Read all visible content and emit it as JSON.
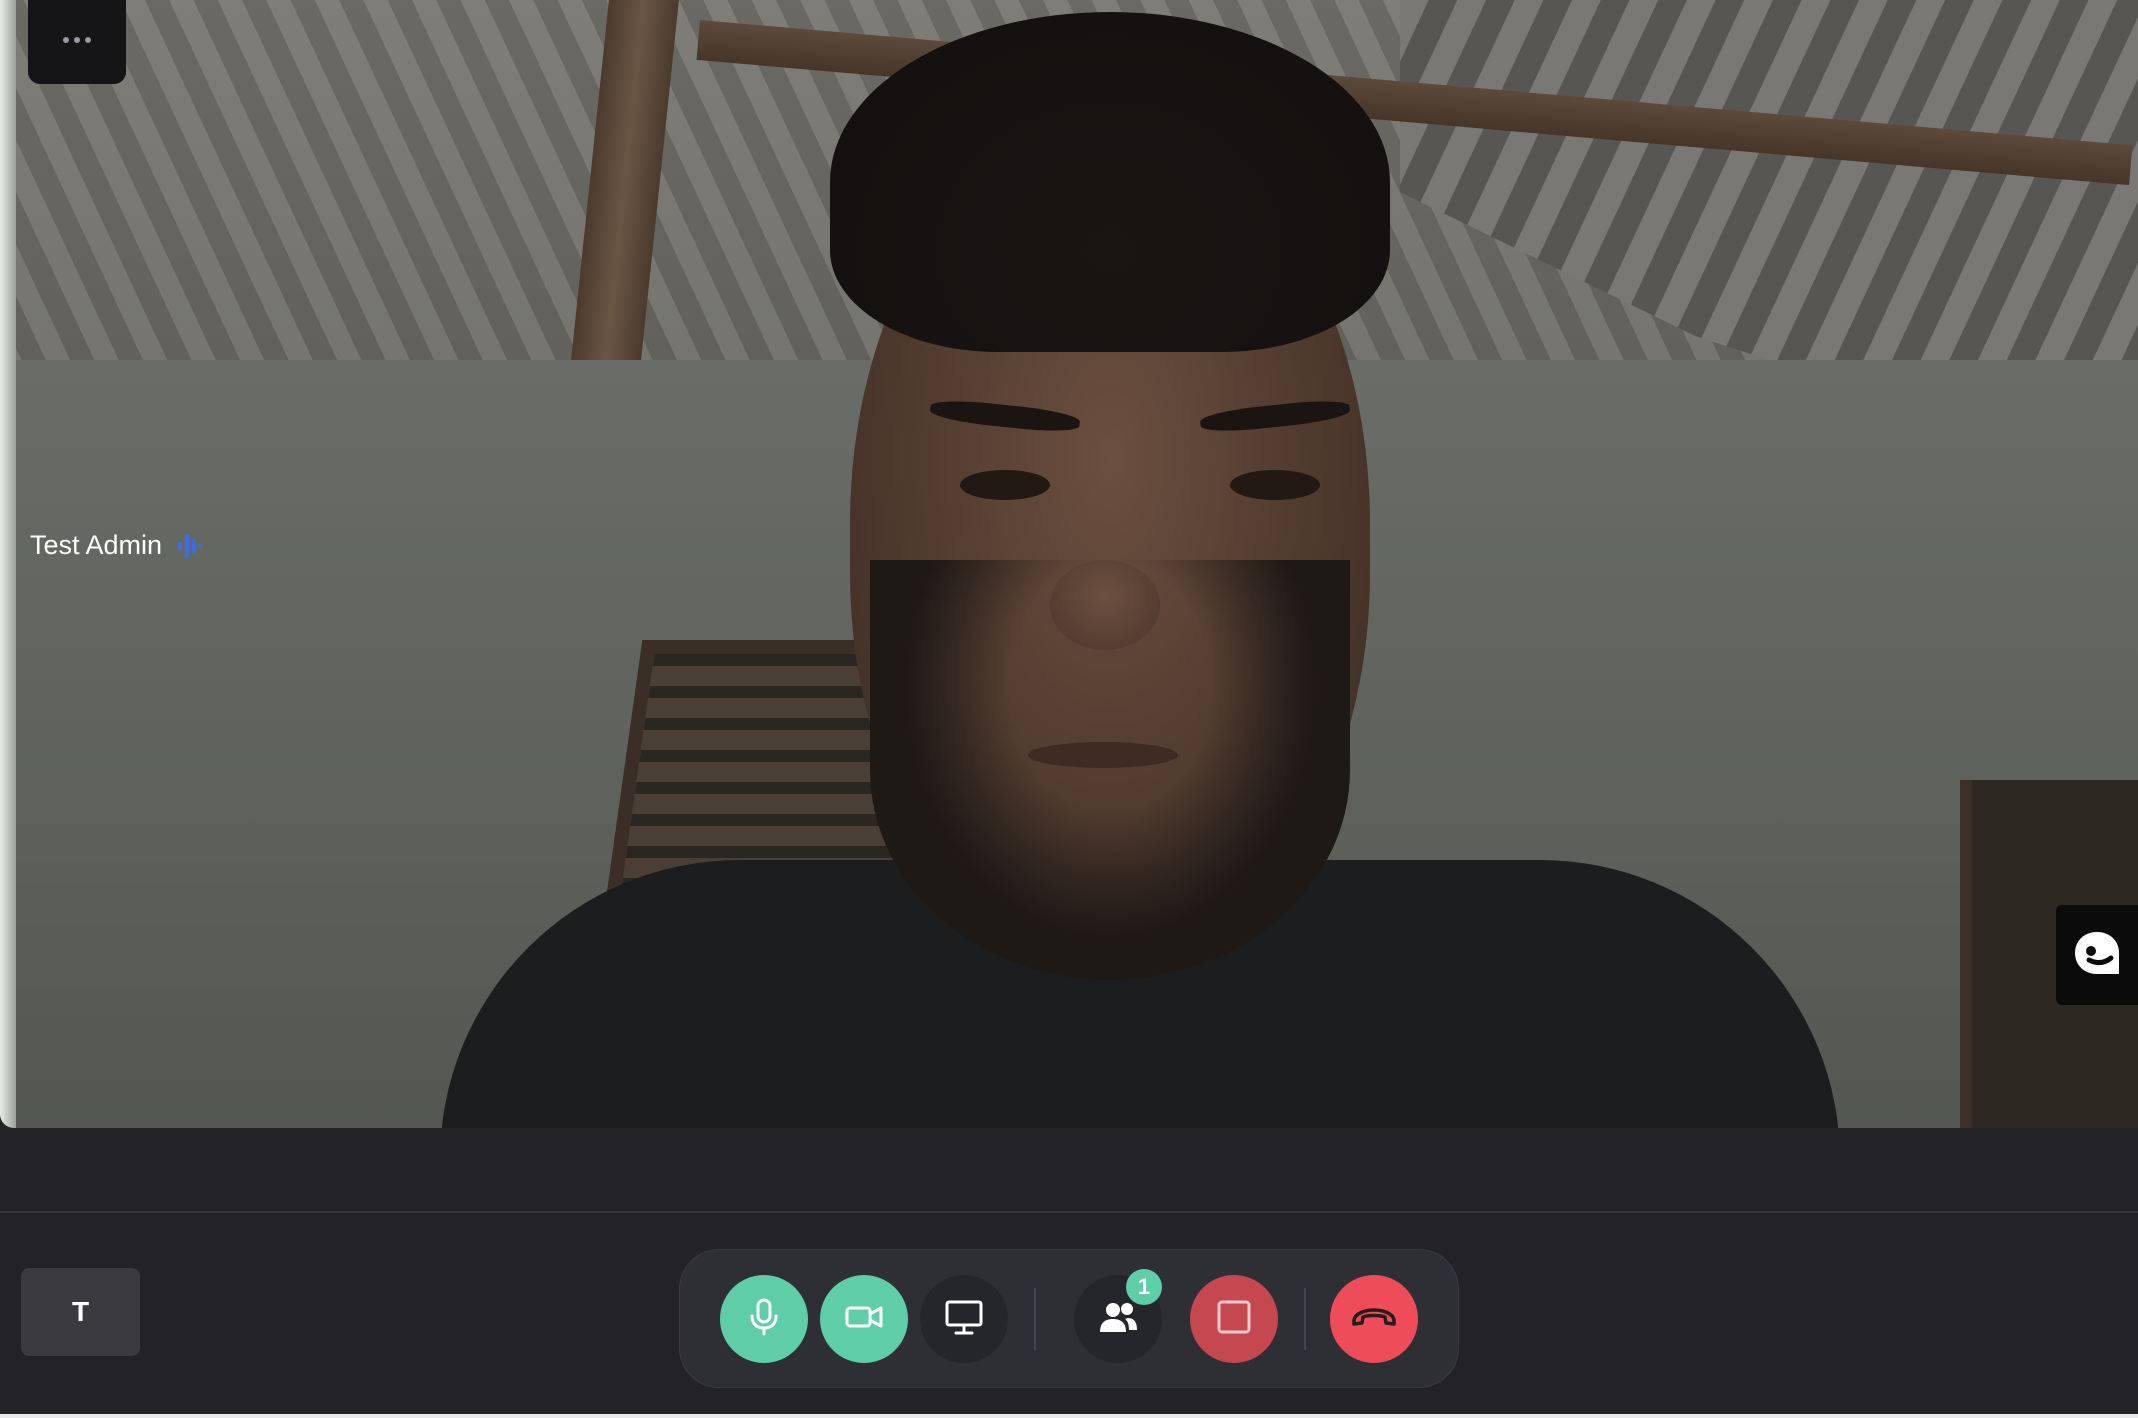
{
  "participant": {
    "name": "Test Admin",
    "speaking_icon": "audio-wave-icon",
    "speaking_color": "#3b6cf0"
  },
  "self_view": {
    "initial": "T"
  },
  "controls": {
    "more_icon": "more-horizontal-icon",
    "mic_icon": "microphone-icon",
    "camera_icon": "video-camera-icon",
    "screen_share_icon": "monitor-icon",
    "participants_icon": "users-icon",
    "participants_count": "1",
    "record_icon": "stop-square-icon",
    "hangup_icon": "phone-hangup-icon",
    "feedback_icon": "chat-bubble-icon"
  },
  "colors": {
    "accent_green": "#5fcea8",
    "record_red": "#c5474f",
    "hangup_red": "#ee4c58",
    "bar_bg": "#222227"
  }
}
